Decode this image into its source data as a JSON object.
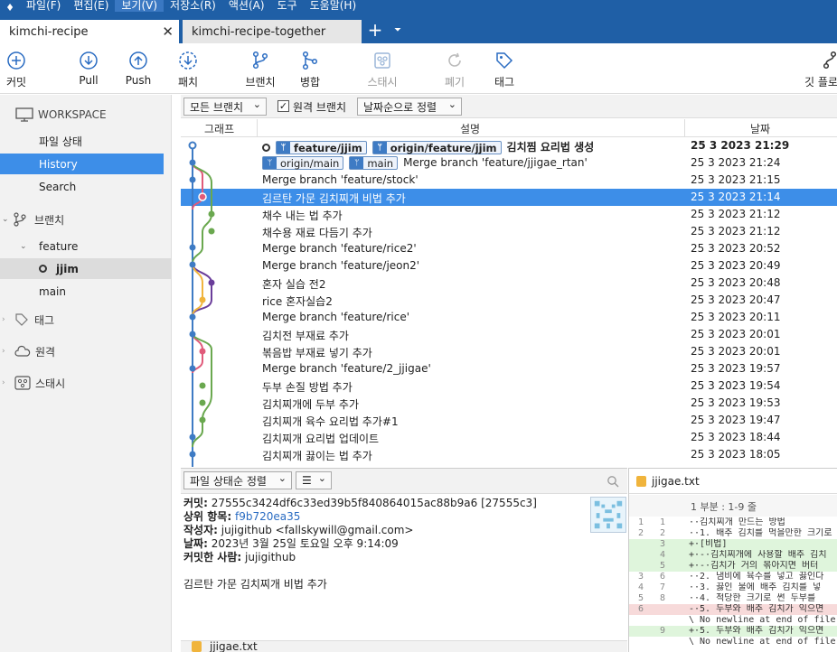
{
  "menu": [
    "파일(F)",
    "편집(E)",
    "보기(V)",
    "저장소(R)",
    "액션(A)",
    "도구",
    "도움말(H)"
  ],
  "tabs": {
    "active": "kimchi-recipe",
    "inactive": "kimchi-recipe-together",
    "add": "+",
    "dropdown": "⏷",
    "close": "✕"
  },
  "toolbar": {
    "commit": "커밋",
    "pull": "Pull",
    "push": "Push",
    "fetch": "패치",
    "branch": "브랜치",
    "merge": "병합",
    "stash": "스태시",
    "discard": "폐기",
    "tag": "태그",
    "gitflow": "깃 플로"
  },
  "sidebar": {
    "workspace": "WORKSPACE",
    "file_status": "파일 상태",
    "history": "History",
    "search": "Search",
    "branches": "브랜치",
    "feature": "feature",
    "jjim": "jjim",
    "main": "main",
    "tags": "태그",
    "remotes": "원격",
    "stashes": "스태시"
  },
  "filter": {
    "branches": "모든 브랜치",
    "remote": "원격 브랜치",
    "sort": "날짜순으로 정렬",
    "checked": "✓"
  },
  "columns": {
    "graph": "그래프",
    "desc": "설명",
    "date": "날짜"
  },
  "commits": [
    {
      "msg": "김치찜 요리법 생성",
      "date": "25 3 2023 21:29"
    },
    {
      "msg": "Merge branch 'feature/jjigae_rtan'",
      "date": "25 3 2023 21:24"
    },
    {
      "msg": "Merge branch 'feature/stock'",
      "date": "25 3 2023 21:15"
    },
    {
      "msg": "김르탄 가문 김치찌개 비법 추가",
      "date": "25 3 2023 21:14"
    },
    {
      "msg": "채수 내는 법 추가",
      "date": "25 3 2023 21:12"
    },
    {
      "msg": "채수용 재료 다듬기 추가",
      "date": "25 3 2023 21:12"
    },
    {
      "msg": "Merge branch 'feature/rice2'",
      "date": "25 3 2023 20:52"
    },
    {
      "msg": "Merge branch 'feature/jeon2'",
      "date": "25 3 2023 20:49"
    },
    {
      "msg": "혼자 실습 전2",
      "date": "25 3 2023 20:48"
    },
    {
      "msg": "rice 혼자실습2",
      "date": "25 3 2023 20:47"
    },
    {
      "msg": "Merge branch 'feature/rice'",
      "date": "25 3 2023 20:11"
    },
    {
      "msg": "김치전 부재료 추가",
      "date": "25 3 2023 20:01"
    },
    {
      "msg": "볶음밥 부재료 넣기 추가",
      "date": "25 3 2023 20:01"
    },
    {
      "msg": "Merge branch 'feature/2_jjigae'",
      "date": "25 3 2023 19:57"
    },
    {
      "msg": "두부 손질 방법 추가",
      "date": "25 3 2023 19:54"
    },
    {
      "msg": "김치찌개에 두부 추가",
      "date": "25 3 2023 19:53"
    },
    {
      "msg": "김치찌개 육수 요리법 추가#1",
      "date": "25 3 2023 19:47"
    },
    {
      "msg": "김치찌개 요리법 업데이트",
      "date": "25 3 2023 18:44"
    },
    {
      "msg": "김치찌개 끓이는 법 추가",
      "date": "25 3 2023 18:05"
    }
  ],
  "refs": {
    "row0": [
      "feature/jjim",
      "origin/feature/jjim"
    ],
    "row1": [
      "origin/main",
      "main"
    ]
  },
  "details": {
    "commit_label": "커밋:",
    "commit": "27555c3424df6c33ed39b5f840864015ac88b9a6 [27555c3]",
    "parent_label": "상위 항목:",
    "parent": "f9b720ea35",
    "author_label": "작성자:",
    "author": "jujigithub <fallskywill@gmail.com>",
    "date_label": "날짜:",
    "date": "2023년 3월 25일 토요일 오후 9:14:09",
    "committer_label": "커밋한 사람:",
    "committer": "jujigithub",
    "message": "김르탄 가문 김치찌개 비법 추가"
  },
  "bottom": {
    "sort": "파일 상태순 정렬",
    "list_icon": "☰",
    "file": "jjigae.txt"
  },
  "diff": {
    "file": "jjigae.txt",
    "hunk": "1 부분 : 1-9 줄",
    "lines": [
      {
        "o": "1",
        "n": "1",
        "type": "ctx",
        "text": "··김치찌개 만드는 방법"
      },
      {
        "o": "2",
        "n": "2",
        "type": "ctx",
        "text": "··1. 배추 김치를 먹을만한 크기로"
      },
      {
        "o": "",
        "n": "3",
        "type": "add",
        "text": "+·[비법]"
      },
      {
        "o": "",
        "n": "4",
        "type": "add",
        "text": "+·-·김치찌개에 사용할 배추 김치"
      },
      {
        "o": "",
        "n": "5",
        "type": "add",
        "text": "+·-·김치가 거의 볶아지면 버터"
      },
      {
        "o": "3",
        "n": "6",
        "type": "ctx",
        "text": "··2. 냄비에 육수를 넣고 끓인다"
      },
      {
        "o": "4",
        "n": "7",
        "type": "ctx",
        "text": "··3. 끓인 물에 배추 김치를 넣"
      },
      {
        "o": "5",
        "n": "8",
        "type": "ctx",
        "text": "··4. 적당한 크기로 썬 두부를"
      },
      {
        "o": "6",
        "n": "",
        "type": "del",
        "text": "-·5. 두부와 배추 김치가 익으면"
      },
      {
        "o": "",
        "n": "",
        "type": "ctx",
        "text": "\\ No newline at end of file"
      },
      {
        "o": "",
        "n": "9",
        "type": "add",
        "text": "+·5. 두부와 배추 김치가 익으면"
      },
      {
        "o": "",
        "n": "",
        "type": "ctx",
        "text": "\\ No newline at end of file"
      }
    ]
  }
}
